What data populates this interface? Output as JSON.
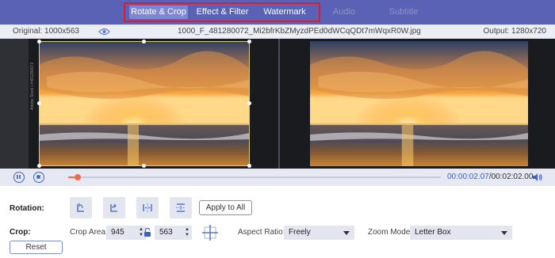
{
  "tabs": [
    {
      "label": "Rotate & Crop",
      "state": "active"
    },
    {
      "label": "Effect & Filter",
      "state": "normal"
    },
    {
      "label": "Watermark",
      "state": "normal"
    },
    {
      "label": "Audio",
      "state": "disabled"
    },
    {
      "label": "Subtitle",
      "state": "disabled"
    }
  ],
  "info": {
    "original": "Original: 1000x563",
    "filename": "1000_F_481280072_Mi2bfrKbZMyzdPEd0dWCqQDt7mWqxR0W.jpg",
    "output": "Output: 1280x720"
  },
  "preview": {
    "side_text": "Adobe Stock | #481280072"
  },
  "playback": {
    "current_time": "00:00:02.07",
    "total_time": "/00:02:02.00",
    "progress": 0.025
  },
  "rotation": {
    "label": "Rotation:",
    "apply_label": "Apply to All"
  },
  "crop": {
    "label": "Crop:",
    "area_label": "Crop Area:",
    "width": "945",
    "height": "563",
    "aspect_label": "Aspect Ratio:",
    "aspect_value": "Freely",
    "zoom_label": "Zoom Mode:",
    "zoom_value": "Letter Box",
    "reset_label": "Reset"
  },
  "colors": {
    "tab_bar": "#5a62b5",
    "highlight": "#e0192e",
    "accent": "#3b62c8",
    "progress": "#f26a4b"
  }
}
